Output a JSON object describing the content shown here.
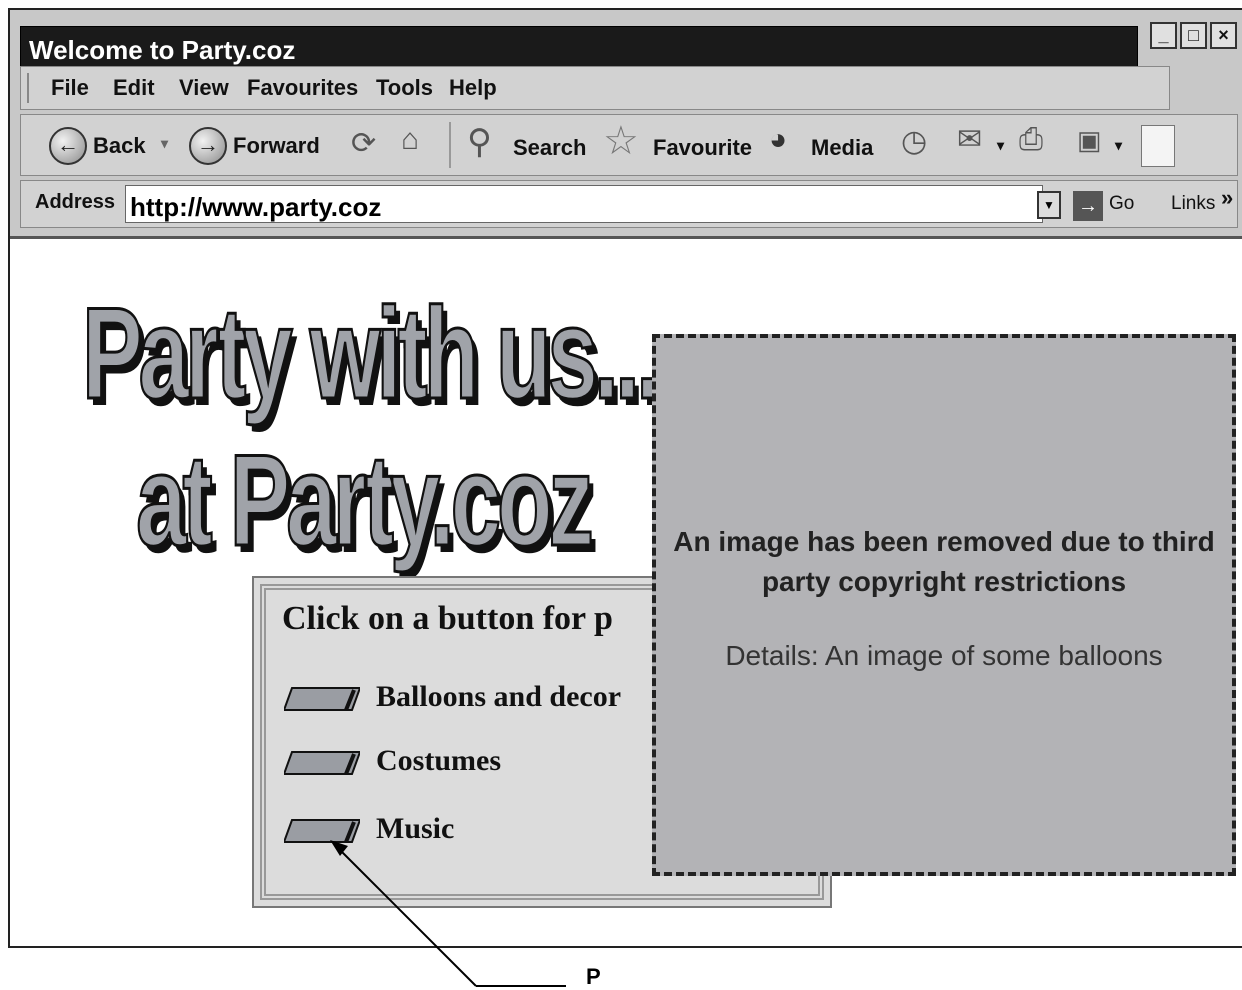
{
  "window": {
    "title": "Welcome to Party.coz",
    "controls": {
      "minimize": "_",
      "maximize": "□",
      "close": "×"
    }
  },
  "menu": [
    "File",
    "Edit",
    "View",
    "Favourites",
    "Tools",
    "Help"
  ],
  "toolbar": {
    "back": "Back",
    "forward": "Forward",
    "search": "Search",
    "favourite": "Favourite",
    "media": "Media"
  },
  "address": {
    "label": "Address",
    "url": "http://www.party.coz",
    "go": "Go",
    "links": "Links",
    "more": "»"
  },
  "page": {
    "headline_line1": "Party with us...",
    "headline_line2": "at Party.coz",
    "panel_title": "Click on a button for p",
    "buttons": [
      "Balloons and decor",
      "Costumes",
      "Music"
    ]
  },
  "placeholder": {
    "title": "An image has been removed due to third party copyright restrictions",
    "detail": "Details: An image of some balloons"
  },
  "annotation": {
    "label": "P"
  }
}
